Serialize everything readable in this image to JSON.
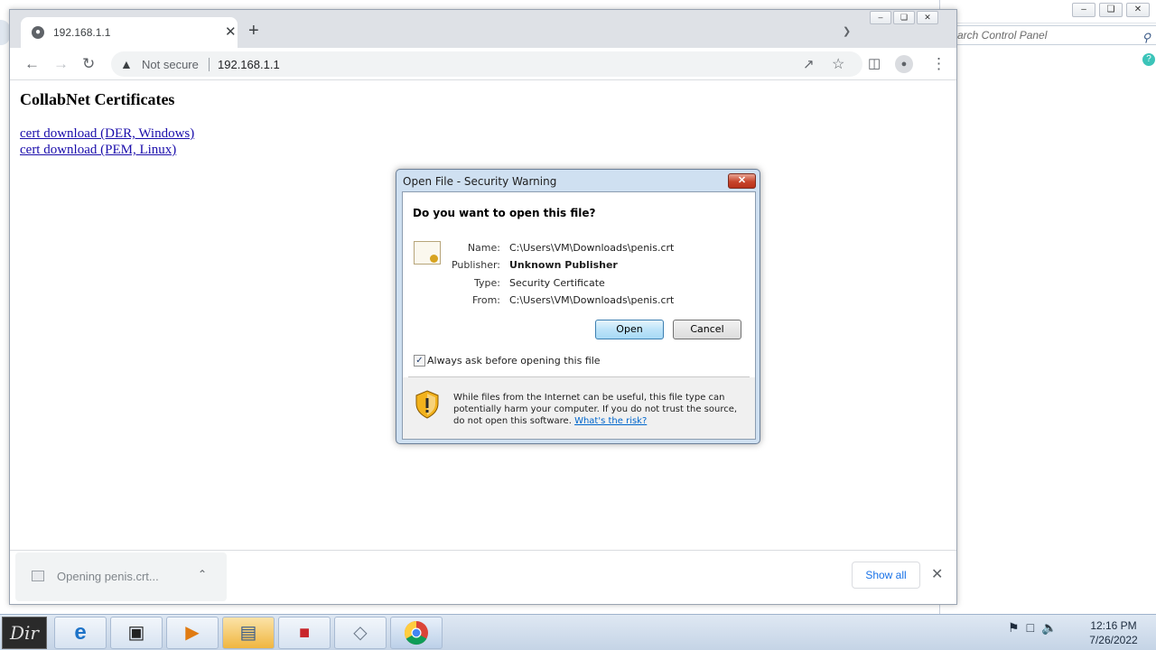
{
  "control_panel": {
    "search_placeholder": "arch Control Panel"
  },
  "browser": {
    "tab_title": "192.168.1.1",
    "security_label": "Not secure",
    "url": "192.168.1.1"
  },
  "page": {
    "title": "CollabNet Certificates",
    "links": [
      "cert download (DER, Windows)",
      "cert download (PEM, Linux)"
    ]
  },
  "download_bar": {
    "item_text": "Opening penis.crt...",
    "show_all_label": "Show all"
  },
  "dialog": {
    "title": "Open File - Security Warning",
    "question": "Do you want to open this file?",
    "fields": [
      {
        "label": "Name:",
        "value": "C:\\Users\\VM\\Downloads\\penis.crt"
      },
      {
        "label": "Publisher:",
        "value": "Unknown Publisher"
      },
      {
        "label": "Type:",
        "value": "Security Certificate"
      },
      {
        "label": "From:",
        "value": "C:\\Users\\VM\\Downloads\\penis.crt"
      }
    ],
    "open_label": "Open",
    "cancel_label": "Cancel",
    "checkbox_label": "Always ask before opening this file",
    "checkbox_checked": true,
    "warning_text": "While files from the Internet can be useful, this file type can potentially harm your computer. If you do not trust the source, do not open this software.",
    "risk_link": "What's the risk?"
  },
  "taskbar": {
    "start_label": "Dir",
    "time": "12:16 PM",
    "date": "7/26/2022"
  },
  "colors": {
    "link": "#1a0dab",
    "accent": "#1a73e8",
    "dialog_frame": "#cfe0f1"
  }
}
